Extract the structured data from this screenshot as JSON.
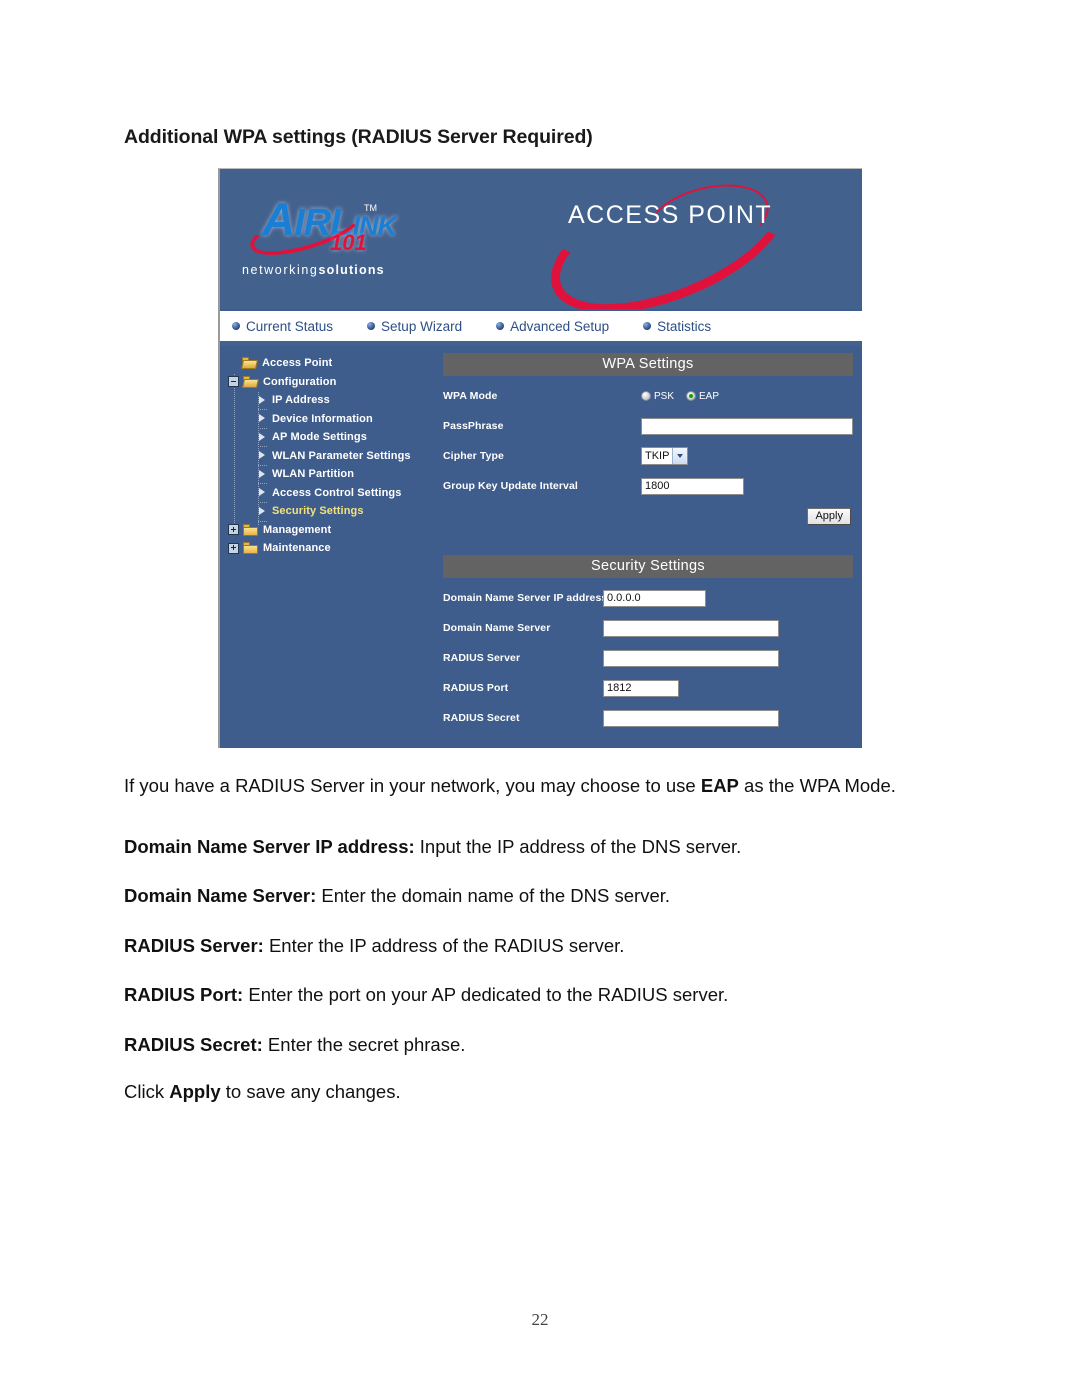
{
  "document": {
    "heading": "Additional WPA settings (RADIUS Server Required)",
    "page_number": "22",
    "paragraphs": [
      {
        "id": "p1",
        "parts": [
          {
            "text": "If you have a RADIUS Server in your network, you may choose to use ",
            "bold": false
          },
          {
            "text": "EAP",
            "bold": true
          },
          {
            "text": " as the WPA Mode.",
            "bold": false
          }
        ]
      },
      {
        "id": "p2",
        "parts": [
          {
            "text": "Domain Name Server IP address:",
            "bold": true
          },
          {
            "text": " Input the IP address of the DNS server.",
            "bold": false
          }
        ]
      },
      {
        "id": "p3",
        "parts": [
          {
            "text": "Domain Name Server:",
            "bold": true
          },
          {
            "text": " Enter the domain name of the DNS server.",
            "bold": false
          }
        ]
      },
      {
        "id": "p4",
        "parts": [
          {
            "text": "RADIUS Server:",
            "bold": true
          },
          {
            "text": " Enter the IP address of the RADIUS server.",
            "bold": false
          }
        ]
      },
      {
        "id": "p5",
        "parts": [
          {
            "text": "RADIUS Port:",
            "bold": true
          },
          {
            "text": " Enter the port on your AP dedicated to the RADIUS server.",
            "bold": false
          }
        ]
      },
      {
        "id": "p6",
        "parts": [
          {
            "text": "RADIUS Secret:",
            "bold": true
          },
          {
            "text": " Enter the secret phrase.",
            "bold": false
          }
        ]
      },
      {
        "id": "p7",
        "parts": [
          {
            "text": "Click ",
            "bold": false
          },
          {
            "text": "Apply",
            "bold": true
          },
          {
            "text": " to save any changes.",
            "bold": false
          }
        ]
      }
    ]
  },
  "screenshot": {
    "banner": {
      "brand_name": "AIRLINK",
      "brand_cap": "A",
      "brand_rest": "IRL",
      "brand_small": "INK",
      "brand_tm": "TM",
      "brand_number": "101",
      "tagline_light": "networking",
      "tagline_bold": "solutions",
      "product_title": "ACCESS POINT",
      "colors": {
        "banner_bg": "#43618d",
        "brand_blue": "#1a7fd4",
        "brand_red": "#e0123c"
      }
    },
    "nav": {
      "items": [
        {
          "label": "Current Status"
        },
        {
          "label": "Setup Wizard"
        },
        {
          "label": "Advanced Setup"
        },
        {
          "label": "Statistics"
        }
      ]
    },
    "tree": {
      "nodes": [
        {
          "label": "Access Point",
          "level": 1,
          "icon": "folder-open",
          "toggle": "none",
          "selected": false
        },
        {
          "label": "Configuration",
          "level": 2,
          "icon": "folder-open",
          "toggle": "minus",
          "selected": false
        },
        {
          "label": "IP Address",
          "level": 3,
          "icon": "arrow",
          "toggle": "none",
          "selected": false
        },
        {
          "label": "Device Information",
          "level": 3,
          "icon": "arrow",
          "toggle": "none",
          "selected": false
        },
        {
          "label": "AP Mode Settings",
          "level": 3,
          "icon": "arrow",
          "toggle": "none",
          "selected": false
        },
        {
          "label": "WLAN Parameter Settings",
          "level": 3,
          "icon": "arrow",
          "toggle": "none",
          "selected": false
        },
        {
          "label": "WLAN Partition",
          "level": 3,
          "icon": "arrow",
          "toggle": "none",
          "selected": false
        },
        {
          "label": "Access Control Settings",
          "level": 3,
          "icon": "arrow",
          "toggle": "none",
          "selected": false
        },
        {
          "label": "Security Settings",
          "level": 3,
          "icon": "arrow",
          "toggle": "none",
          "selected": true
        },
        {
          "label": "Management",
          "level": 2,
          "icon": "folder-closed",
          "toggle": "plus",
          "selected": false
        },
        {
          "label": "Maintenance",
          "level": 2,
          "icon": "folder-closed",
          "toggle": "plus",
          "selected": false
        }
      ]
    },
    "wpa_panel": {
      "title": "WPA Settings",
      "mode_label": "WPA Mode",
      "mode_options": [
        {
          "label": "PSK",
          "selected": false
        },
        {
          "label": "EAP",
          "selected": true
        }
      ],
      "passphrase_label": "PassPhrase",
      "passphrase_value": "",
      "cipher_label": "Cipher Type",
      "cipher_value": "TKIP",
      "group_key_label": "Group Key Update Interval",
      "group_key_value": "1800",
      "apply_label": "Apply"
    },
    "security_panel": {
      "title": "Security Settings",
      "rows": [
        {
          "label": "Domain Name Server IP address",
          "value": "0.0.0.0",
          "size": "medium"
        },
        {
          "label": "Domain Name Server",
          "value": "",
          "size": "secwide"
        },
        {
          "label": "RADIUS Server",
          "value": "",
          "size": "secwide"
        },
        {
          "label": "RADIUS Port",
          "value": "1812",
          "size": "short"
        },
        {
          "label": "RADIUS Secret",
          "value": "",
          "size": "secwide"
        }
      ]
    }
  }
}
